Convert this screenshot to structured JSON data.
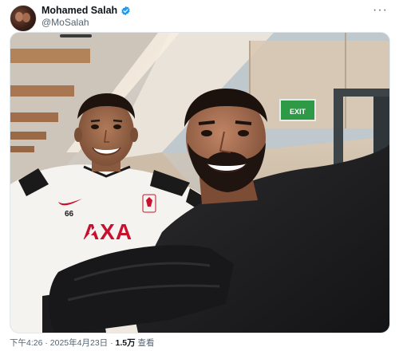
{
  "author": {
    "display_name": "Mohamed Salah",
    "handle": "@MoSalah",
    "verified": true,
    "badge_color": "#1d9bf0"
  },
  "menu_icon": "more-horizontal-icon",
  "media": {
    "jersey_number": "66",
    "sponsor": "AXA",
    "exit_sign": "EXIT",
    "colors": {
      "sponsor_red": "#c8102e",
      "exit_green": "#2e9a46"
    }
  },
  "footer": {
    "time": "下午4:26",
    "sep1": " · ",
    "date": "2025年4月23日",
    "sep2": " · ",
    "views_count": "1.5万",
    "views_label": " 查看"
  }
}
